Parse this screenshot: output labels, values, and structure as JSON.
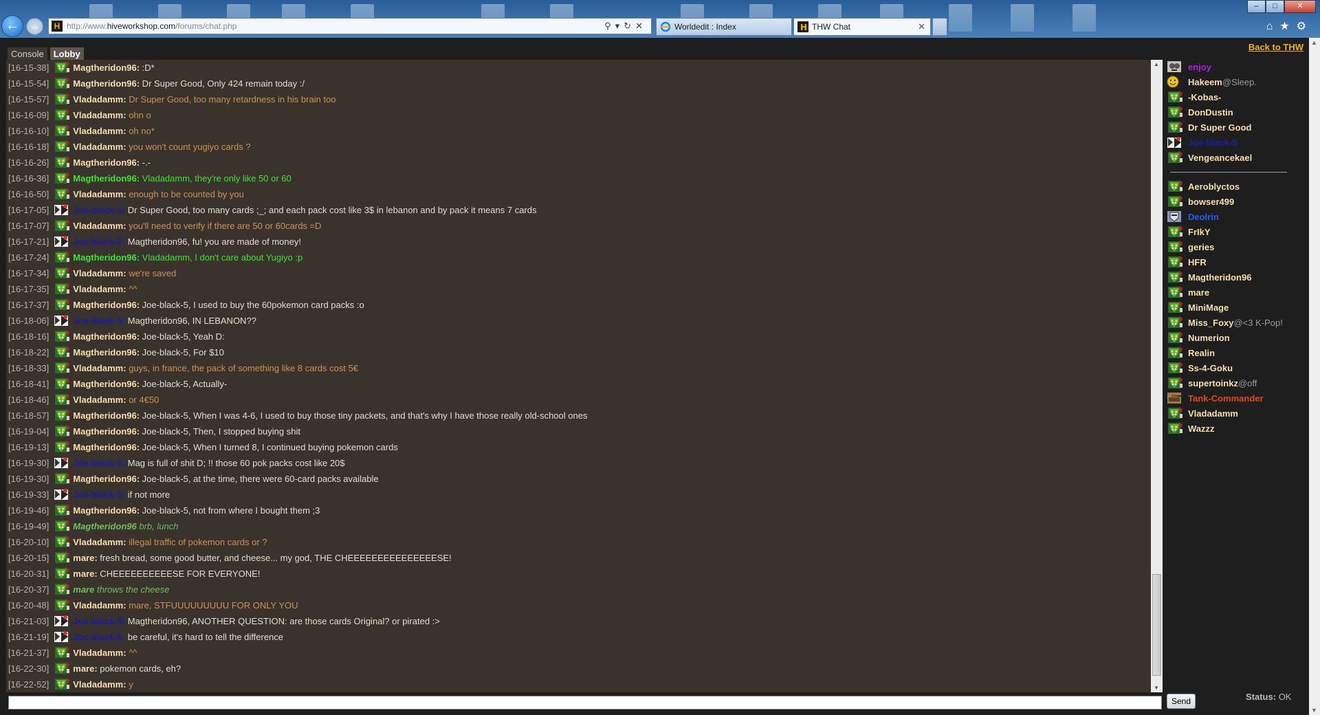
{
  "browser": {
    "url_prefix": "http://www.",
    "url_domain": "hiveworkshop.com",
    "url_path": "/forums/chat.php",
    "tabs": [
      {
        "label": "Worldedit : Index"
      },
      {
        "label": "THW Chat"
      }
    ]
  },
  "page": {
    "back_link": "Back to THW",
    "tabs": [
      {
        "label": "Console"
      },
      {
        "label": "Lobby"
      }
    ],
    "send_label": "Send",
    "status_label": "Status:",
    "status_value": "OK"
  },
  "colors": {
    "name_default": "#f5deae",
    "text_default": "#e4dccd",
    "vlad_text": "#c8954f",
    "green_highlight": "#3ae62f",
    "action_green": "#6fbf5a",
    "joe_blue": "#1a1ca8",
    "deolrin_blue": "#2a5af0",
    "enjoy_purple": "#b020d8",
    "tank_red": "#e04a1a",
    "link_gold": "#f0b030"
  },
  "messages": [
    {
      "time": "[16-15-38]",
      "user": "Magtheridon96:",
      "text": " :D*",
      "style": "normal",
      "avatar": "orc"
    },
    {
      "time": "[16-15-54]",
      "user": "Magtheridon96:",
      "text": " Dr Super Good, Only 424 remain today :/",
      "style": "normal",
      "avatar": "orc"
    },
    {
      "time": "[16-15-57]",
      "user": "Vladadamm:",
      "text": " Dr Super Good, too many retardness in his brain too",
      "style": "vlad",
      "avatar": "orc"
    },
    {
      "time": "[16-16-09]",
      "user": "Vladadamm:",
      "text": " ohn o",
      "style": "vlad",
      "avatar": "orc"
    },
    {
      "time": "[16-16-10]",
      "user": "Vladadamm:",
      "text": " oh no*",
      "style": "vlad",
      "avatar": "orc"
    },
    {
      "time": "[16-16-18]",
      "user": "Vladadamm:",
      "text": " you won't count yugiyo cards ?",
      "style": "vlad",
      "avatar": "orc"
    },
    {
      "time": "[16-16-26]",
      "user": "Magtheridon96:",
      "text": " -.-",
      "style": "normal",
      "avatar": "orc"
    },
    {
      "time": "[16-16-36]",
      "user": "Magtheridon96:",
      "text": " Vladadamm, they're only like 50 or 60",
      "style": "green",
      "avatar": "orc"
    },
    {
      "time": "[16-16-50]",
      "user": "Vladadamm:",
      "text": " enough to be counted by you",
      "style": "vlad",
      "avatar": "orc"
    },
    {
      "time": "[16-17-05]",
      "user": "Joe-black-5:",
      "text": " Dr Super Good, too many cards ;_; and each pack cost like 3$ in lebanon and by pack it means 7 cards",
      "style": "joe",
      "avatar": "joe"
    },
    {
      "time": "[16-17-07]",
      "user": "Vladadamm:",
      "text": " you'll need to verify if there are 50 or 60cards =D",
      "style": "vlad",
      "avatar": "orc"
    },
    {
      "time": "[16-17-21]",
      "user": "Joe-black-5:",
      "text": " Magtheridon96, fu! you are made of money!",
      "style": "joe",
      "avatar": "joe"
    },
    {
      "time": "[16-17-24]",
      "user": "Magtheridon96:",
      "text": " Vladadamm, I don't care about Yugiyo :p",
      "style": "green",
      "avatar": "orc"
    },
    {
      "time": "[16-17-34]",
      "user": "Vladadamm:",
      "text": " we're saved",
      "style": "vlad",
      "avatar": "orc"
    },
    {
      "time": "[16-17-35]",
      "user": "Vladadamm:",
      "text": " ^^",
      "style": "vlad",
      "avatar": "orc"
    },
    {
      "time": "[16-17-37]",
      "user": "Magtheridon96:",
      "text": " Joe-black-5, I used to buy the 60pokemon card packs :o",
      "style": "normal",
      "avatar": "orc"
    },
    {
      "time": "[16-18-06]",
      "user": "Joe-black-5:",
      "text": " Magtheridon96, IN LEBANON??",
      "style": "joe",
      "avatar": "joe"
    },
    {
      "time": "[16-18-16]",
      "user": "Magtheridon96:",
      "text": " Joe-black-5, Yeah D:",
      "style": "normal",
      "avatar": "orc"
    },
    {
      "time": "[16-18-22]",
      "user": "Magtheridon96:",
      "text": " Joe-black-5, For $10",
      "style": "normal",
      "avatar": "orc"
    },
    {
      "time": "[16-18-33]",
      "user": "Vladadamm:",
      "text": " guys, in france, the pack of something like 8 cards cost 5€",
      "style": "vlad",
      "avatar": "orc"
    },
    {
      "time": "[16-18-41]",
      "user": "Magtheridon96:",
      "text": " Joe-black-5, Actually-",
      "style": "normal",
      "avatar": "orc"
    },
    {
      "time": "[16-18-46]",
      "user": "Vladadamm:",
      "text": " or 4€50",
      "style": "vlad",
      "avatar": "orc"
    },
    {
      "time": "[16-18-57]",
      "user": "Magtheridon96:",
      "text": " Joe-black-5, When I was 4-6, I used to buy those tiny packets, and that's why I have those really old-school ones",
      "style": "normal",
      "avatar": "orc"
    },
    {
      "time": "[16-19-04]",
      "user": "Magtheridon96:",
      "text": " Joe-black-5, Then, I stopped buying shit",
      "style": "normal",
      "avatar": "orc"
    },
    {
      "time": "[16-19-13]",
      "user": "Magtheridon96:",
      "text": " Joe-black-5, When I turned 8, I continued buying pokemon cards",
      "style": "normal",
      "avatar": "orc"
    },
    {
      "time": "[16-19-30]",
      "user": "Joe-black-5:",
      "text": " Mag is full of shit D; !! those 60 pok packs cost like 20$",
      "style": "joe",
      "avatar": "joe"
    },
    {
      "time": "[16-19-30]",
      "user": "Magtheridon96:",
      "text": " Joe-black-5, at the time, there were 60-card packs available",
      "style": "normal",
      "avatar": "orc"
    },
    {
      "time": "[16-19-33]",
      "user": "Joe-black-5:",
      "text": " if not more",
      "style": "joe",
      "avatar": "joe"
    },
    {
      "time": "[16-19-46]",
      "user": "Magtheridon96:",
      "text": " Joe-black-5, not from where I bought them ;3",
      "style": "normal",
      "avatar": "orc"
    },
    {
      "time": "[16-19-49]",
      "user": "Magtheridon96",
      "text": " brb, lunch",
      "style": "action",
      "avatar": "orc"
    },
    {
      "time": "[16-20-10]",
      "user": "Vladadamm:",
      "text": " illegal traffic of pokemon cards or ?",
      "style": "vlad",
      "avatar": "orc"
    },
    {
      "time": "[16-20-15]",
      "user": "mare:",
      "text": " fresh bread, some good butter, and cheese... my god, THE CHEEEEEEEEEEEEEEESE!",
      "style": "normal",
      "avatar": "orc"
    },
    {
      "time": "[16-20-31]",
      "user": "mare:",
      "text": " CHEEEEEEEEEESE FOR EVERYONE!",
      "style": "normal",
      "avatar": "orc"
    },
    {
      "time": "[16-20-37]",
      "user": "mare",
      "text": " throws the cheese",
      "style": "action",
      "avatar": "orc"
    },
    {
      "time": "[16-20-48]",
      "user": "Vladadamm:",
      "text": " mare, STFUUUUUUUUU FOR ONLY YOU",
      "style": "vlad",
      "avatar": "orc"
    },
    {
      "time": "[16-21-03]",
      "user": "Joe-black-5:",
      "text": " Magtheridon96, ANOTHER QUESTION: are those cards Original? or pirated :>",
      "style": "joe",
      "avatar": "joe"
    },
    {
      "time": "[16-21-19]",
      "user": "Joe-black-5:",
      "text": " be careful, it's hard to tell the difference",
      "style": "joe",
      "avatar": "joe"
    },
    {
      "time": "[16-21-37]",
      "user": "Vladadamm:",
      "text": " ^^",
      "style": "vlad",
      "avatar": "orc"
    },
    {
      "time": "[16-22-30]",
      "user": "mare:",
      "text": " pokemon cards, eh?",
      "style": "normal",
      "avatar": "orc"
    },
    {
      "time": "[16-22-52]",
      "user": "Vladadamm:",
      "text": " y",
      "style": "vlad",
      "avatar": "orc"
    }
  ],
  "users_top": [
    {
      "name": "enjoy",
      "status": "",
      "color": "purple",
      "avatar": "ghoul"
    },
    {
      "name": "Hakeem",
      "status": "@Sleep.",
      "color": "default",
      "avatar": "smiley"
    },
    {
      "name": "-Kobas-",
      "status": "",
      "color": "default",
      "avatar": "orc"
    },
    {
      "name": "DonDustin",
      "status": "",
      "color": "default",
      "avatar": "orc"
    },
    {
      "name": "Dr Super Good",
      "status": "",
      "color": "default",
      "avatar": "orc"
    },
    {
      "name": "Joe-black-5",
      "status": "",
      "color": "joe",
      "avatar": "joe"
    },
    {
      "name": "Vengeancekael",
      "status": "",
      "color": "default",
      "avatar": "orc"
    }
  ],
  "users_bottom": [
    {
      "name": "Aeroblyctos",
      "status": "",
      "color": "default",
      "avatar": "orc"
    },
    {
      "name": "bowser499",
      "status": "",
      "color": "default",
      "avatar": "orc"
    },
    {
      "name": "Deolrin",
      "status": "",
      "color": "deolrin",
      "avatar": "knight"
    },
    {
      "name": "FrIkY",
      "status": "",
      "color": "default",
      "avatar": "orc"
    },
    {
      "name": "geries",
      "status": "",
      "color": "default",
      "avatar": "orc"
    },
    {
      "name": "HFR",
      "status": "",
      "color": "default",
      "avatar": "orc"
    },
    {
      "name": "Magtheridon96",
      "status": "",
      "color": "default",
      "avatar": "orc"
    },
    {
      "name": "mare",
      "status": "",
      "color": "default",
      "avatar": "orc"
    },
    {
      "name": "MiniMage",
      "status": "",
      "color": "default",
      "avatar": "orc"
    },
    {
      "name": "Miss_Foxy",
      "status": "@<3 K-Pop!",
      "color": "default",
      "avatar": "orc"
    },
    {
      "name": "Numerion",
      "status": "",
      "color": "default",
      "avatar": "orc"
    },
    {
      "name": "Realin",
      "status": "",
      "color": "default",
      "avatar": "orc"
    },
    {
      "name": "Ss-4-Goku",
      "status": "",
      "color": "default",
      "avatar": "orc"
    },
    {
      "name": "supertoinkz",
      "status": "@off",
      "color": "default",
      "avatar": "orc"
    },
    {
      "name": "Tank-Commander",
      "status": "",
      "color": "tank",
      "avatar": "tank"
    },
    {
      "name": "Vladadamm",
      "status": "",
      "color": "default",
      "avatar": "orc"
    },
    {
      "name": "Wazzz",
      "status": "",
      "color": "default",
      "avatar": "orc"
    }
  ]
}
